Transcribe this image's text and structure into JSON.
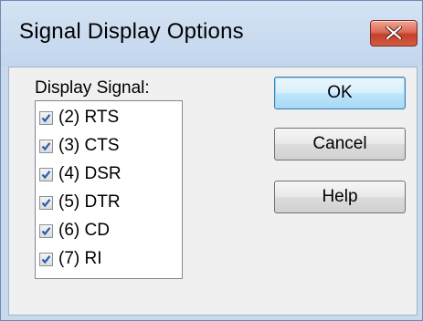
{
  "window": {
    "title": "Signal Display Options",
    "close_icon": "close-icon"
  },
  "signals": {
    "label": "Display Signal:",
    "items": [
      {
        "label": "(2) RTS",
        "checked": true
      },
      {
        "label": "(3) CTS",
        "checked": true
      },
      {
        "label": "(4) DSR",
        "checked": true
      },
      {
        "label": "(5) DTR",
        "checked": true
      },
      {
        "label": "(6) CD",
        "checked": true
      },
      {
        "label": "(7) RI",
        "checked": true
      }
    ]
  },
  "buttons": {
    "ok": "OK",
    "cancel": "Cancel",
    "help": "Help"
  },
  "colors": {
    "accent": "#3c7fb1",
    "close": "#c4402a",
    "check": "#2a5ea8"
  }
}
